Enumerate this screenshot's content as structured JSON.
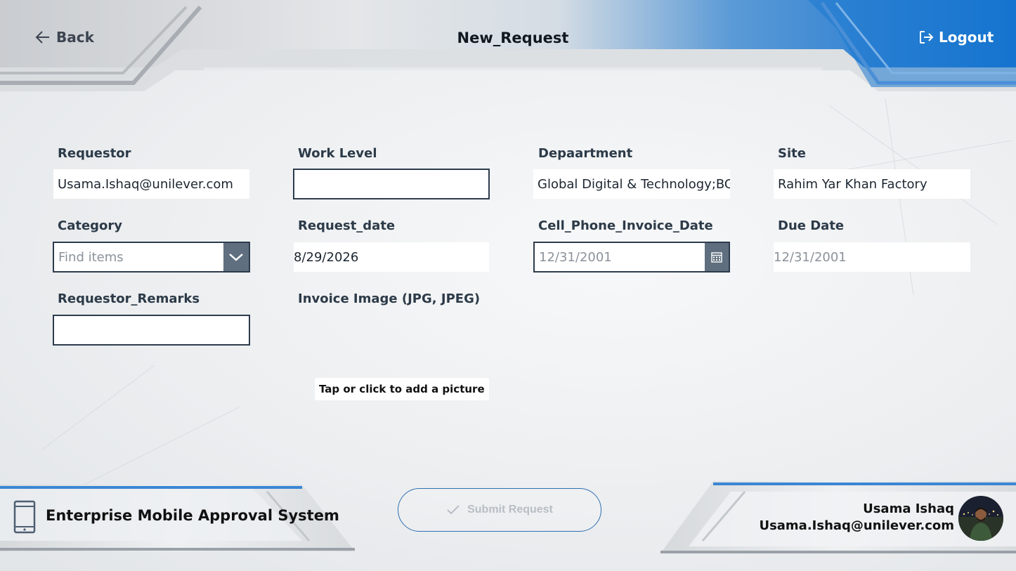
{
  "header": {
    "back_label": "Back",
    "title": "New_Request",
    "logout_label": "Logout"
  },
  "form": {
    "requestor": {
      "label": "Requestor",
      "value": "Usama.Ishaq@unilever.com"
    },
    "work_level": {
      "label": "Work Level",
      "value": ""
    },
    "department": {
      "label": "Depaartment",
      "value": "Global Digital & Technology;BGA"
    },
    "site": {
      "label": "Site",
      "value": "Rahim Yar Khan Factory"
    },
    "category": {
      "label": "Category",
      "placeholder": "Find items"
    },
    "request_date": {
      "label": "Request_date",
      "value": "8/29/2026"
    },
    "invoice_date": {
      "label": "Cell_Phone_Invoice_Date",
      "placeholder": "12/31/2001"
    },
    "due_date": {
      "label": "Due Date",
      "placeholder": "12/31/2001"
    },
    "remarks": {
      "label": "Requestor_Remarks",
      "value": ""
    },
    "invoice_image": {
      "label": "Invoice Image (JPG, JPEG)",
      "add_picture": "Tap or click to add a picture"
    }
  },
  "footer": {
    "app_name": "Enterprise Mobile Approval System",
    "submit_label": "Submit Request",
    "user_name": "Usama Ishaq",
    "user_email": "Usama.Ishaq@unilever.com"
  },
  "icons": {
    "back": "arrow-left-icon",
    "logout": "logout-icon",
    "dropdown": "chevron-down-icon",
    "calendar": "calendar-icon",
    "check": "check-icon",
    "app": "mobile-device-icon"
  },
  "colors": {
    "accent_blue": "#1a73c8",
    "field_border": "#2d3c4c",
    "button_dark": "#5f6f7f"
  }
}
